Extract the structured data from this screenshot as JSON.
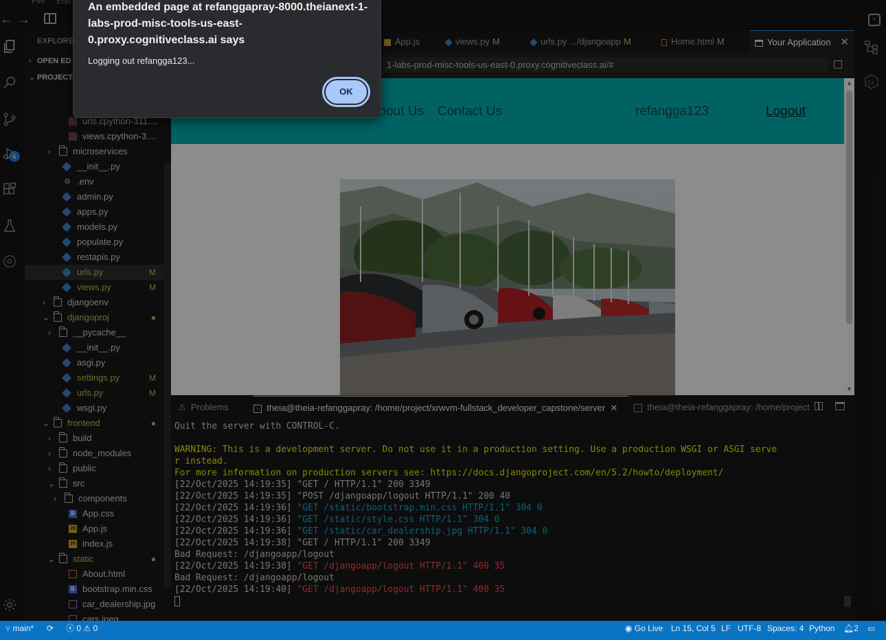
{
  "menubar": {
    "menu_file": "File",
    "menu_edit": "Edit"
  },
  "activity": {
    "scm_badge": "6"
  },
  "sidebar": {
    "title": "EXPLORER",
    "open_editors": "OPEN ED",
    "project": "PROJECT",
    "items": [
      {
        "label": "urls.cpython-311....",
        "type": "pyc"
      },
      {
        "label": "views.cpython-3....",
        "type": "pyc"
      },
      {
        "label": "microservices",
        "type": "folder"
      },
      {
        "label": "__init__.py",
        "type": "py"
      },
      {
        "label": ".env",
        "type": "cfg"
      },
      {
        "label": "admin.py",
        "type": "py"
      },
      {
        "label": "apps.py",
        "type": "py"
      },
      {
        "label": "models.py",
        "type": "py"
      },
      {
        "label": "populate.py",
        "type": "py"
      },
      {
        "label": "restapis.py",
        "type": "py"
      },
      {
        "label": "urls.py",
        "type": "py",
        "status": "M"
      },
      {
        "label": "views.py",
        "type": "py",
        "status": "M"
      },
      {
        "label": "djangoenv",
        "type": "folder"
      },
      {
        "label": "djangoproj",
        "type": "folder-open",
        "status": "●"
      },
      {
        "label": "__pycache__",
        "type": "folder"
      },
      {
        "label": "__init__.py",
        "type": "py"
      },
      {
        "label": "asgi.py",
        "type": "py"
      },
      {
        "label": "settings.py",
        "type": "py",
        "status": "M"
      },
      {
        "label": "urls.py",
        "type": "py",
        "status": "M"
      },
      {
        "label": "wsgi.py",
        "type": "py"
      },
      {
        "label": "frontend",
        "type": "folder-open",
        "status": "●"
      },
      {
        "label": "build",
        "type": "folder"
      },
      {
        "label": "node_modules",
        "type": "folder"
      },
      {
        "label": "public",
        "type": "folder"
      },
      {
        "label": "src",
        "type": "folder-open"
      },
      {
        "label": "components",
        "type": "folder"
      },
      {
        "label": "App.css",
        "type": "css"
      },
      {
        "label": "App.js",
        "type": "js"
      },
      {
        "label": "index.js",
        "type": "js"
      },
      {
        "label": "static",
        "type": "folder-open",
        "status": "●"
      },
      {
        "label": "About.html",
        "type": "html"
      },
      {
        "label": "bootstrap.min.css",
        "type": "css"
      },
      {
        "label": "car_dealership.jpg",
        "type": "img"
      },
      {
        "label": "cars.jpeg",
        "type": "img"
      }
    ]
  },
  "tabs": [
    {
      "label": "App.js",
      "icon": "JS"
    },
    {
      "label": "views.py",
      "mod": "M"
    },
    {
      "label": "urls.py",
      "detail": ".../djangoapp",
      "mod": "M"
    },
    {
      "label": "Home.html",
      "mod": "M"
    },
    {
      "label": "Your Application"
    }
  ],
  "url": "1-labs-prod-misc-tools-us-east-0.proxy.cognitiveclass.ai/#",
  "app": {
    "nav_about": "About Us",
    "nav_contact": "Contact Us",
    "username": "refangga123",
    "logout": "Logout"
  },
  "panel": {
    "problems": "Problems",
    "term1": "theia@theia-refanggapray: /home/project/xrwvm-fullstack_developer_capstone/server",
    "term2": "theia@theia-refanggapray: /home/project",
    "lines": [
      {
        "text": "Quit the server with CONTROL-C.",
        "kind": "plain"
      },
      {
        "text": "",
        "kind": "plain"
      },
      {
        "text": "WARNING: This is a development server. Do not use it in a production setting. Use a production WSGI or ASGI serve",
        "kind": "warn"
      },
      {
        "text": "r instead.",
        "kind": "warn"
      },
      {
        "text": "For more information on production servers see: https://docs.djangoproject.com/en/5.2/howto/deployment/",
        "kind": "warn"
      },
      {
        "text": "[22/Oct/2025 14:19:35] \"GET / HTTP/1.1\" 200 3349",
        "kind": "plain"
      },
      {
        "text": "[22/Oct/2025 14:19:35] \"POST /djangoapp/logout HTTP/1.1\" 200 40",
        "kind": "plain"
      },
      {
        "prefix": "[22/Oct/2025 14:19:36] ",
        "text": "\"GET /static/bootstrap.min.css HTTP/1.1\" 304 0",
        "kind": "cyan"
      },
      {
        "prefix": "[22/Oct/2025 14:19:36] ",
        "text": "\"GET /static/style.css HTTP/1.1\" 304 0",
        "kind": "cyan"
      },
      {
        "prefix": "[22/Oct/2025 14:19:36] ",
        "text": "\"GET /static/car_dealership.jpg HTTP/1.1\" 304 0",
        "kind": "cyan"
      },
      {
        "text": "[22/Oct/2025 14:19:38] \"GET / HTTP/1.1\" 200 3349",
        "kind": "plain"
      },
      {
        "text": "Bad Request: /djangoapp/logout",
        "kind": "plain"
      },
      {
        "prefix": "[22/Oct/2025 14:19:38] ",
        "text": "\"GET /djangoapp/logout HTTP/1.1\" 400 35",
        "kind": "red"
      },
      {
        "text": "Bad Request: /djangoapp/logout",
        "kind": "plain"
      },
      {
        "prefix": "[22/Oct/2025 14:19:40] ",
        "text": "\"GET /djangoapp/logout HTTP/1.1\" 400 35",
        "kind": "red"
      }
    ]
  },
  "statusbar": {
    "branch": "main*",
    "errors": "0",
    "warnings": "0",
    "golive": "Go Live",
    "position": "Ln 15, Col 5",
    "eol": "LF",
    "encoding": "UTF-8",
    "spaces": "Spaces: 4",
    "language": "Python",
    "notifications": "2"
  },
  "dialog": {
    "title": "An embedded page at refanggapray-8000.theianext-1-labs-prod-misc-tools-us-east-0.proxy.cognitiveclass.ai says",
    "message": "Logging out refangga123...",
    "ok": "OK"
  },
  "colors": {
    "accent": "#0a74c4",
    "nav_teal": "#00a9a9",
    "dialog_button": "#a8c7fa",
    "modified": "#c5b356"
  }
}
